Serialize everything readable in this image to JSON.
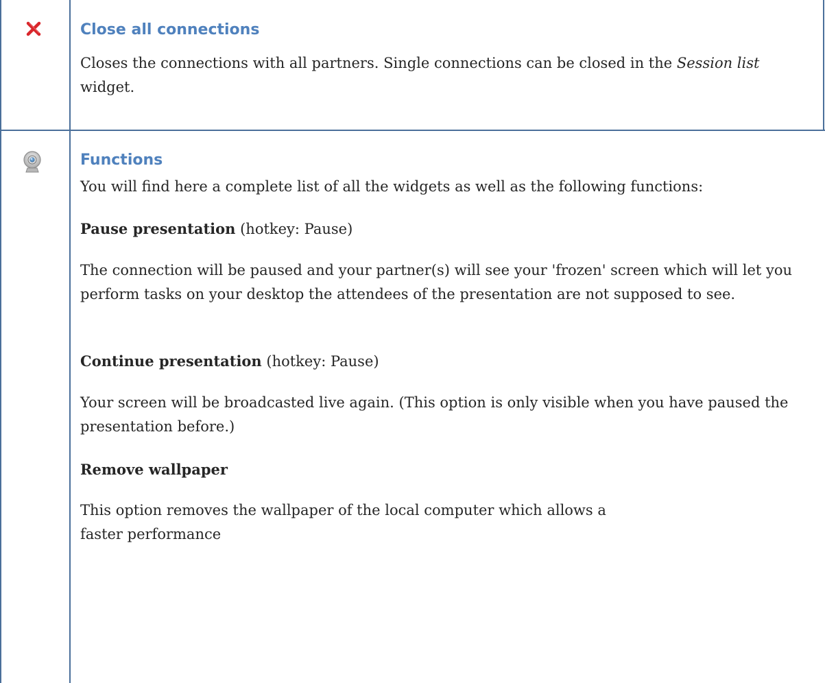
{
  "rows": [
    {
      "icon": "close-icon",
      "heading": "Close all connections",
      "paragraph": {
        "text_before": "Closes the connections with all partners. Single connections can be closed in the ",
        "italic": "Session list",
        "text_after": " widget."
      }
    },
    {
      "icon": "webcam-icon",
      "heading": "Functions",
      "intro": "You will find here a complete list of all the widgets as well as the following functions:",
      "items": [
        {
          "title": "Pause presentation",
          "suffix": " (hotkey: Pause)",
          "description": "The connection will be paused and your partner(s) will see your 'frozen' screen which will let you perform tasks on your desktop the attendees of the presentation are not supposed to see."
        },
        {
          "title": "Continue presentation",
          "suffix": " (hotkey: Pause)",
          "description": "Your screen will be broadcasted live again. (This option is only visible when you have paused the presentation before.)"
        },
        {
          "title": "Remove wallpaper",
          "suffix": "",
          "description": "This option removes the wallpaper of the local computer which allows a faster performance"
        }
      ]
    }
  ],
  "colors": {
    "heading": "#4f81bd",
    "border": "#4a6f9a",
    "text": "#262626",
    "close_icon": "#d9262b"
  }
}
